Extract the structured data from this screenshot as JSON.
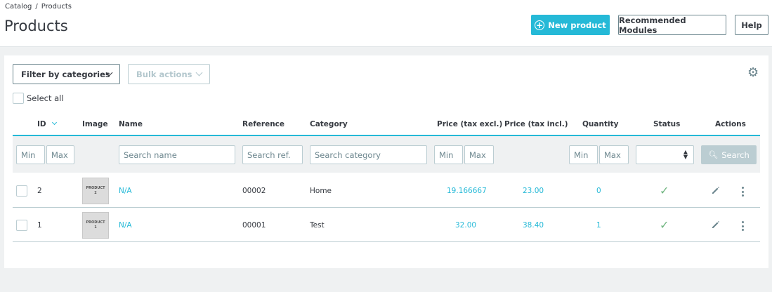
{
  "breadcrumb": {
    "parent": "Catalog",
    "separator": "/",
    "current": "Products"
  },
  "page_title": "Products",
  "toolbar": {
    "new_product": "New product",
    "new_product_icon": "plus-circle-icon",
    "recommended_modules": "Recommended Modules",
    "help": "Help"
  },
  "filters": {
    "filter_by_categories": "Filter by categories",
    "bulk_actions": "Bulk actions",
    "select_all": "Select all"
  },
  "columns": [
    "ID",
    "Image",
    "Name",
    "Reference",
    "Category",
    "Price (tax excl.)",
    "Price (tax incl.)",
    "Quantity",
    "Status",
    "Actions"
  ],
  "search": {
    "id_min": "Min",
    "id_max": "Max",
    "name": "Search name",
    "reference": "Search ref.",
    "category": "Search category",
    "price_min": "Min",
    "price_max": "Max",
    "qty_min": "Min",
    "qty_max": "Max",
    "status_value": "",
    "button": "Search"
  },
  "rows": [
    {
      "id": "2",
      "thumb_line1": "PRODUCT",
      "thumb_line2": "2",
      "name": "N/A",
      "reference": "00002",
      "category": "Home",
      "price_excl": "19.166667",
      "price_incl": "23.00",
      "quantity": "0",
      "status": "enabled"
    },
    {
      "id": "1",
      "thumb_line1": "PRODUCT",
      "thumb_line2": "1",
      "name": "N/A",
      "reference": "00001",
      "category": "Test",
      "price_excl": "32.00",
      "price_incl": "38.40",
      "quantity": "1",
      "status": "enabled"
    }
  ],
  "colors": {
    "accent": "#25b9d7",
    "status_ok": "#70b580",
    "muted": "#6c868e",
    "border": "#bbcdd2"
  }
}
